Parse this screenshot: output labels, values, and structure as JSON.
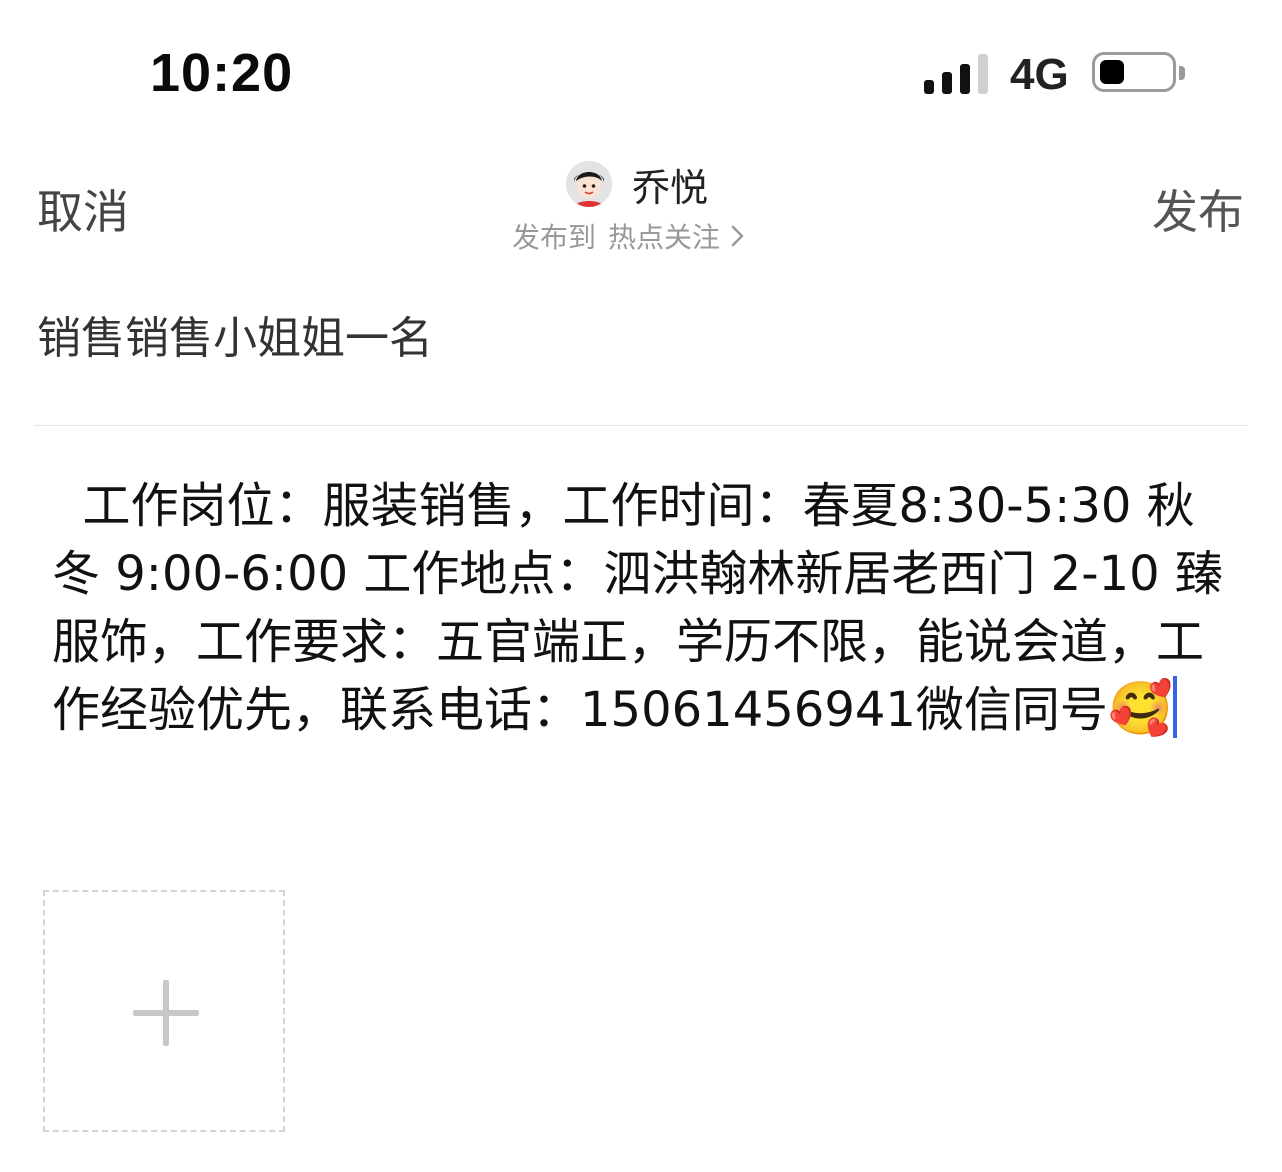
{
  "status_bar": {
    "time": "10:20",
    "network": "4G",
    "signal_bars_filled": 3,
    "signal_bars_total": 4,
    "battery_level": 0.35,
    "signal_icon": "cellular-signal-icon",
    "battery_icon": "battery-icon"
  },
  "nav": {
    "cancel_label": "取消",
    "publish_label": "发布",
    "username": "乔悦",
    "publish_to_label": "发布到",
    "publish_topic": "热点关注",
    "chevron_icon": "chevron-right-icon"
  },
  "post": {
    "title": "销售销售小姐姐一名",
    "body": "  工作岗位：服装销售，工作时间：春夏8:30-5:30 秋冬 9:00-6:00 工作地点：泗洪翰林新居老西门 2-10 臻服饰，工作要求：五官端正，学历不限，能说会道，工作经验优先，联系电话：15061456941微信同号",
    "emoji": "🥰"
  },
  "add_image": {
    "icon": "plus-icon"
  },
  "colors": {
    "caret": "#3a63e6",
    "muted_text": "#999999",
    "divider": "#e4e4e4"
  }
}
